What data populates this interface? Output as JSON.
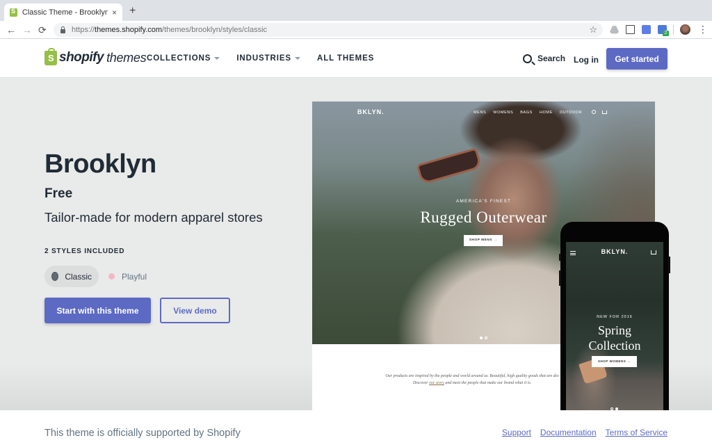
{
  "browser": {
    "tab": {
      "title": "Classic Theme - Brooklyn Ecom",
      "favicon": "shopify-bag-icon"
    },
    "new_tab_label": "+",
    "close_tab_label": "×",
    "url": {
      "scheme": "https://",
      "host": "themes.shopify.com",
      "path": "/themes/brooklyn/styles/classic"
    },
    "icons": {
      "back": "←",
      "forward": "→",
      "reload": "⟳",
      "bookmark": "☆",
      "menu": "⋮"
    },
    "extensions": [
      "google-drive-icon",
      "screen-capture-icon",
      "tag-icon",
      "code-inspector-icon"
    ],
    "extension_badge": "2"
  },
  "header": {
    "logo_word": "shopify",
    "logo_sub": "themes",
    "nav": [
      {
        "label": "COLLECTIONS",
        "has_dropdown": true
      },
      {
        "label": "INDUSTRIES",
        "has_dropdown": true
      },
      {
        "label": "ALL THEMES",
        "has_dropdown": false
      }
    ],
    "search_label": "Search",
    "login_label": "Log in",
    "cta_label": "Get started"
  },
  "theme": {
    "name": "Brooklyn",
    "price": "Free",
    "tagline": "Tailor-made for modern apparel stores",
    "styles_heading": "2 STYLES INCLUDED",
    "styles": [
      {
        "label": "Classic",
        "color": "#626a73",
        "selected": true
      },
      {
        "label": "Playful",
        "color": "#f4b6c6",
        "selected": false
      }
    ],
    "primary_button": "Start with this theme",
    "secondary_button": "View demo"
  },
  "desktop_preview": {
    "store_logo": "BKLYN.",
    "menu": [
      "MENS",
      "WOMENS",
      "BAGS",
      "HOME",
      "OUTDOOR"
    ],
    "eyebrow": "AMERICA'S FINEST",
    "headline": "Rugged Outerwear",
    "cta": "SHOP MENS →",
    "slides": 2,
    "active_slide": 1,
    "copy_line1": "Our products are inspired by the people and world around us. Beautiful, high quality goods that are des",
    "copy_line2_pre": "Discover ",
    "copy_link": "our story",
    "copy_line2_post": " and meet the people that make our brand what it is."
  },
  "mobile_preview": {
    "store_logo": "BKLYN.",
    "eyebrow": "NEW FOR 2016",
    "headline_line1": "Spring",
    "headline_line2": "Collection",
    "cta": "SHOP WOMENS →",
    "slides": 2,
    "active_slide": 2
  },
  "footer": {
    "note": "This theme is officially supported by Shopify",
    "links": [
      "Support",
      "Documentation",
      "Terms of Service"
    ]
  },
  "colors": {
    "brand_accent": "#5c6ac4",
    "shopify_green": "#95bf47",
    "text_dark": "#212b36",
    "text_muted": "#637381",
    "hero_bg": "#e9eaea"
  }
}
